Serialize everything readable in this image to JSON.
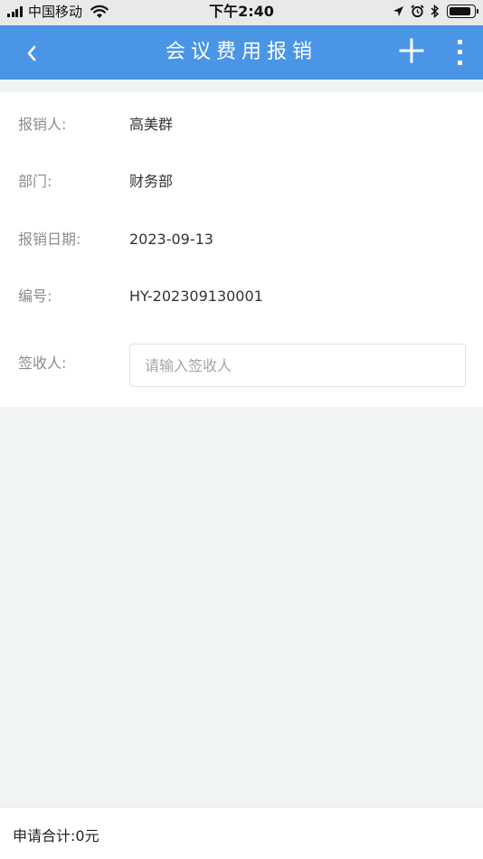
{
  "status_bar": {
    "carrier": "中国移动",
    "time": "下午2:40"
  },
  "header": {
    "title": "会议费用报销"
  },
  "form": {
    "applicant_label": "报销人:",
    "applicant_value": "高美群",
    "department_label": "部门:",
    "department_value": "财务部",
    "date_label": "报销日期:",
    "date_value": "2023-09-13",
    "number_label": "编号:",
    "number_value": "HY-202309130001",
    "receiver_label": "签收人:",
    "receiver_placeholder": "请输入签收人",
    "receiver_value": ""
  },
  "footer": {
    "total_text": "申请合计:0元"
  },
  "colors": {
    "nav_bg": "#4a95e6",
    "page_bg": "#f0f4f5"
  },
  "icons": {
    "back": "chevron-left-icon",
    "add": "plus-icon",
    "more": "more-vertical-icon",
    "wifi": "wifi-icon",
    "location": "location-arrow-icon",
    "alarm": "alarm-icon",
    "bluetooth": "bluetooth-icon",
    "battery": "battery-icon"
  }
}
